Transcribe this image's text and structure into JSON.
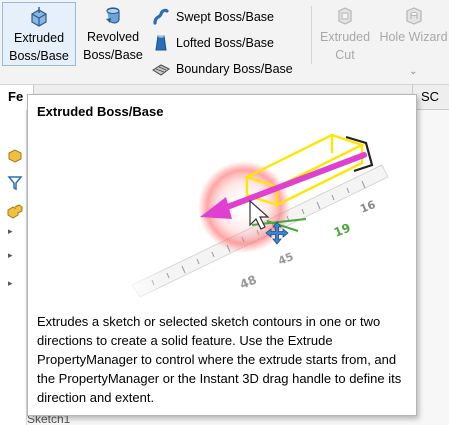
{
  "ribbon": {
    "extruded": {
      "line1": "Extruded",
      "line2": "Boss/Base",
      "icon": "extrude-icon"
    },
    "revolved": {
      "line1": "Revolved",
      "line2": "Boss/Base",
      "icon": "revolve-icon"
    },
    "swept": {
      "label": "Swept Boss/Base",
      "icon": "swept-icon"
    },
    "lofted": {
      "label": "Lofted Boss/Base",
      "icon": "lofted-icon"
    },
    "boundary": {
      "label": "Boundary Boss/Base",
      "icon": "boundary-icon"
    },
    "extruded_cut": {
      "line1": "Extruded",
      "line2": "Cut",
      "icon": "extruded-cut-icon",
      "disabled": true
    },
    "hole_wizard": {
      "line1": "Hole Wizard",
      "icon": "hole-wizard-icon",
      "disabled": true
    },
    "dropdown_glyph": "⌄"
  },
  "tabs": [
    {
      "label": "Fe",
      "active": true
    },
    {
      "label": "SC",
      "active": false
    }
  ],
  "tooltip": {
    "title": "Extruded Boss/Base",
    "description": "Extrudes a sketch or selected sketch contours in one or two directions to create a solid feature. Use the Extrude PropertyManager to control where the extrude starts from, and the PropertyManager or the Instant 3D drag handle to define its direction and extent.",
    "ruler_labels": [
      "16",
      "19",
      "45",
      "48"
    ]
  },
  "tree": {
    "visible_item": "Sketch1"
  },
  "colors": {
    "accent_blue": "#2a6fb5",
    "arrow_magenta": "#e040d0",
    "box_yellow": "#ffe600",
    "ruler_green": "#48a83c"
  }
}
